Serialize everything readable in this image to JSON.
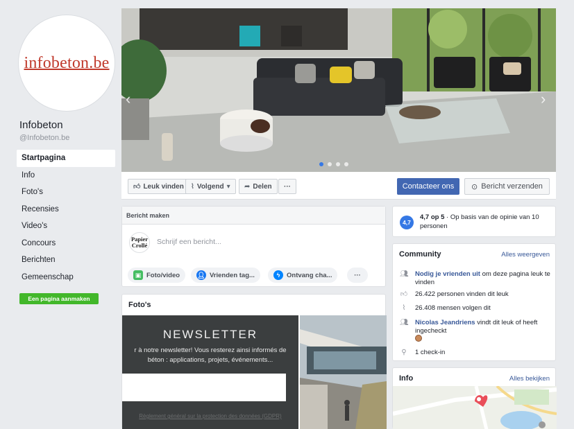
{
  "page": {
    "logo_text": "infobeton.be",
    "name": "Infobeton",
    "handle": "@Infobeton.be"
  },
  "nav": {
    "items": [
      {
        "label": "Startpagina",
        "active": true
      },
      {
        "label": "Info"
      },
      {
        "label": "Foto's"
      },
      {
        "label": "Recensies"
      },
      {
        "label": "Video's"
      },
      {
        "label": "Concours"
      },
      {
        "label": "Berichten"
      },
      {
        "label": "Gemeenschap"
      }
    ],
    "create_page": "Een pagina aanmaken"
  },
  "cover": {
    "slides": 4,
    "active_slide": 1
  },
  "actions": {
    "like": "Leuk vinden",
    "follow": "Volgend",
    "share": "Delen",
    "more": "···",
    "contact": "Contacteer ons",
    "message": "Bericht verzenden"
  },
  "composer": {
    "title": "Bericht maken",
    "avatar_line1": "Papier",
    "avatar_line2": "Crollé",
    "placeholder": "Schrijf een bericht...",
    "photo_video": "Foto/video",
    "tag_friends": "Vrienden tag...",
    "get_messages": "Ontvang cha...",
    "more": "···"
  },
  "photos": {
    "title": "Foto's",
    "newsletter_title": "NEWSLETTER",
    "newsletter_line1": "r à notre newsletter! Vous resterez ainsi informés de",
    "newsletter_line2": "béton : applications, projets, événements...",
    "newsletter_footer": "Règlement général sur la protection des données (GDPR)"
  },
  "rating": {
    "score": "4,7",
    "strong": "4,7 op 5",
    "rest": " · Op basis van de opinie van 10 personen"
  },
  "community": {
    "title": "Community",
    "link": "Alles weergeven",
    "invite_link": "Nodig je vrienden uit",
    "invite_rest": " om deze pagina leuk te vinden",
    "likes": "26.422 personen vinden dit leuk",
    "follows": "26.408 mensen volgen dit",
    "friend_link": "Nicolas Jeandriens",
    "friend_rest": " vindt dit leuk of heeft ingecheckt",
    "checkins": "1 check-in"
  },
  "info": {
    "title": "Info",
    "link": "Alles bekijken"
  },
  "colors": {
    "fb_blue": "#4267b2",
    "link_blue": "#385898",
    "create_green": "#42b72a",
    "logo_red": "#c0392b"
  }
}
